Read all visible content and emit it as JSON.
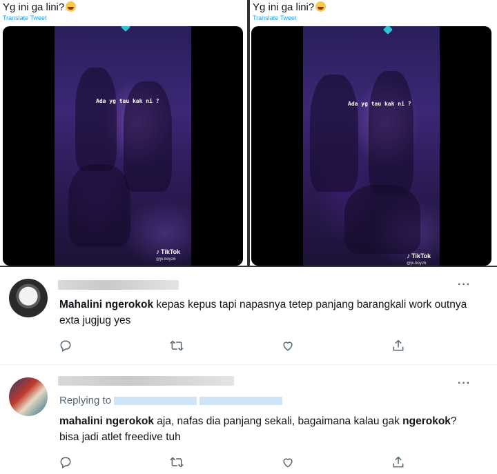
{
  "panels": [
    {
      "tweet_text": "Yg ini ga lini?",
      "translate_label": "Translate Tweet",
      "caption": "Ada yg tau kak ni ?",
      "watermark": "TikTok",
      "handle": "@jk.boy26"
    },
    {
      "tweet_text": "Yg ini ga lini?",
      "translate_label": "Translate Tweet",
      "caption": "Ada yg tau kak ni ?",
      "watermark": "TikTok",
      "handle": "@jk.boy26"
    }
  ],
  "replies": [
    {
      "more": "···",
      "text_bold": "Mahalini ngerokok",
      "text_rest": " kepas kepus tapi napasnya tetep panjang barangkali work outnya exta jugjug yes"
    },
    {
      "more": "···",
      "replying_label": "Replying to",
      "text_bold_1": "mahalini ngerokok",
      "text_mid": " aja, nafas dia panjang sekali, bagaimana kalau gak ",
      "text_bold_2": "ngerokok",
      "text_end": "? bisa jadi atlet freedive tuh"
    }
  ],
  "icons": [
    "reply-icon",
    "retweet-icon",
    "like-icon",
    "share-icon",
    "more-icon",
    "tiktok-icon",
    "laughing-emoji-icon"
  ],
  "colors": {
    "link": "#1d9bf0",
    "text": "#0f1419",
    "muted": "#536471",
    "video_tint": "#3b2775"
  }
}
